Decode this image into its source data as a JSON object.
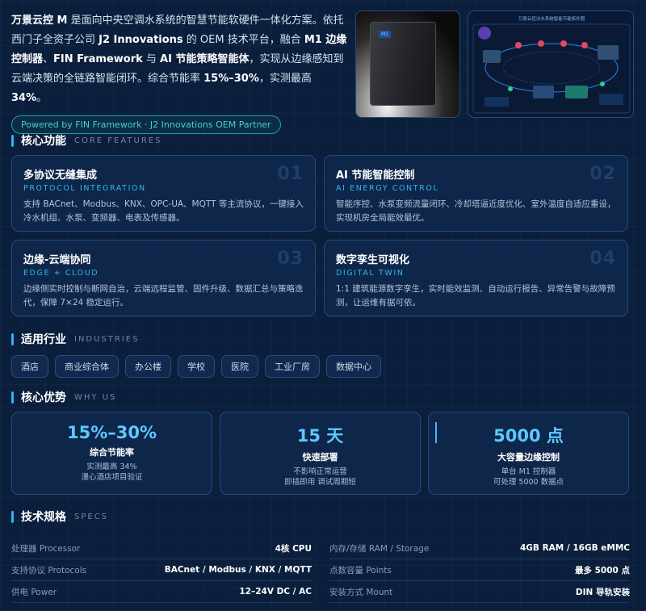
{
  "intro": {
    "p1": "万景云控 M",
    "p2": " 是面向中央空调水系统的智慧节能软硬件一体化方案。依托西门子全资子公司 ",
    "p3": "J2 Innovations",
    "p4": " 的 OEM 技术平台，融合 ",
    "p5": "M1 边缘控制器",
    "p6": "、",
    "p7": "FIN Framework",
    "p8": " 与 ",
    "p9": "AI 节能策略智能体",
    "p10": "，实现从边缘感知到云端决策的全链路智能闭环。综合节能率 ",
    "p11": "15%–30%",
    "p12": "，实测最高 ",
    "p13": "34%",
    "p14": "。",
    "badge": "Powered by FIN Framework · J2 Innovations OEM Partner"
  },
  "hero": {
    "cabinet_label": "M1",
    "diagram_title": "万景云控冰水系统智能节能拓扑图"
  },
  "features": {
    "title": "核心功能",
    "subtitle": "CORE FEATURES",
    "items": [
      {
        "title": "多协议无缝集成",
        "en": "PROTOCOL INTEGRATION",
        "desc": "支持 BACnet、Modbus、KNX、OPC-UA、MQTT 等主流协议，一键接入冷水机组、水泵、变频器、电表及传感器。",
        "num": "01"
      },
      {
        "title": "AI 节能智能控制",
        "en": "AI ENERGY CONTROL",
        "desc": "智能序控、水泵变频流量闭环、冷却塔逼近度优化、室外温度自适应重设，实现机房全局能效最优。",
        "num": "02"
      },
      {
        "title": "边缘-云端协同",
        "en": "EDGE + CLOUD",
        "desc": "边缘侧实时控制与断网自治，云端远程监管、固件升级、数据汇总与策略迭代，保障 7×24 稳定运行。",
        "num": "03"
      },
      {
        "title": "数字孪生可视化",
        "en": "DIGITAL TWIN",
        "desc": "1:1 建筑能源数字孪生，实时能效监测、自动运行报告、异常告警与故障预测，让运维有据可依。",
        "num": "04"
      }
    ]
  },
  "industries": {
    "title": "适用行业",
    "subtitle": "INDUSTRIES",
    "tags": [
      "酒店",
      "商业综合体",
      "办公楼",
      "学校",
      "医院",
      "工业厂房",
      "数据中心"
    ]
  },
  "advantages": {
    "title": "核心优势",
    "subtitle": "WHY US",
    "items": [
      {
        "value": "15%–30%",
        "label": "综合节能率",
        "desc1": "实测最高 34%",
        "desc2": "漫心酒店项目验证"
      },
      {
        "value": "15 天",
        "label": "快速部署",
        "desc1": "不影响正常运营",
        "desc2": "即插即用 调试周期短"
      },
      {
        "value": "5000 点",
        "label": "大容量边缘控制",
        "desc1": "单台 M1 控制器",
        "desc2": "可处理 5000 数据点"
      }
    ]
  },
  "specs": {
    "title": "技术规格",
    "subtitle": "SPECS",
    "rows": [
      {
        "k": "处理器 Processor",
        "v": "4核 CPU"
      },
      {
        "k": "内存/存储 RAM / Storage",
        "v": "4GB RAM / 16GB eMMC"
      },
      {
        "k": "支持协议 Protocols",
        "v": "BACnet / Modbus / KNX / MQTT"
      },
      {
        "k": "点数容量 Points",
        "v": "最多 5000 点"
      },
      {
        "k": "供电 Power",
        "v": "12–24V DC / AC"
      },
      {
        "k": "安装方式 Mount",
        "v": "DIN 导轨安装"
      }
    ]
  },
  "colors": {
    "accent": "#2fb3ff",
    "teal": "#46d0cf",
    "bg": "#0b1f3c"
  }
}
